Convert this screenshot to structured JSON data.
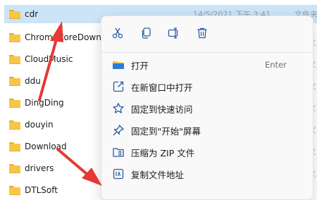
{
  "files": [
    {
      "name": "cdr",
      "date": "14/5/2021 下午 3:41",
      "type": "文件夹",
      "selected": true
    },
    {
      "name": "ChromeCoreDownloads",
      "selected": false
    },
    {
      "name": "CloudMusic",
      "selected": false
    },
    {
      "name": "ddu",
      "selected": false
    },
    {
      "name": "DingDing",
      "selected": false
    },
    {
      "name": "douyin",
      "selected": false
    },
    {
      "name": "Download",
      "selected": false
    },
    {
      "name": "drivers",
      "selected": false
    },
    {
      "name": "DTLSoft",
      "selected": false
    }
  ],
  "toolbar": [
    {
      "name": "cut-icon"
    },
    {
      "name": "copy-icon"
    },
    {
      "name": "rename-icon"
    },
    {
      "name": "delete-icon"
    }
  ],
  "menu": [
    {
      "label": "打开",
      "shortcut": "Enter",
      "icon": "open-folder-icon"
    },
    {
      "label": "在新窗口中打开",
      "shortcut": "",
      "icon": "open-new-window-icon"
    },
    {
      "label": "固定到快速访问",
      "shortcut": "",
      "icon": "star-icon"
    },
    {
      "label": "固定到\"开始\"屏幕",
      "shortcut": "",
      "icon": "pin-icon"
    },
    {
      "label": "压缩为 ZIP 文件",
      "shortcut": "",
      "icon": "zip-icon"
    },
    {
      "label": "复制文件地址",
      "shortcut": "",
      "icon": "copy-path-icon"
    }
  ],
  "colors": {
    "accent": "#0067c0",
    "selection": "#cce4f7",
    "arrow": "#e53935"
  }
}
